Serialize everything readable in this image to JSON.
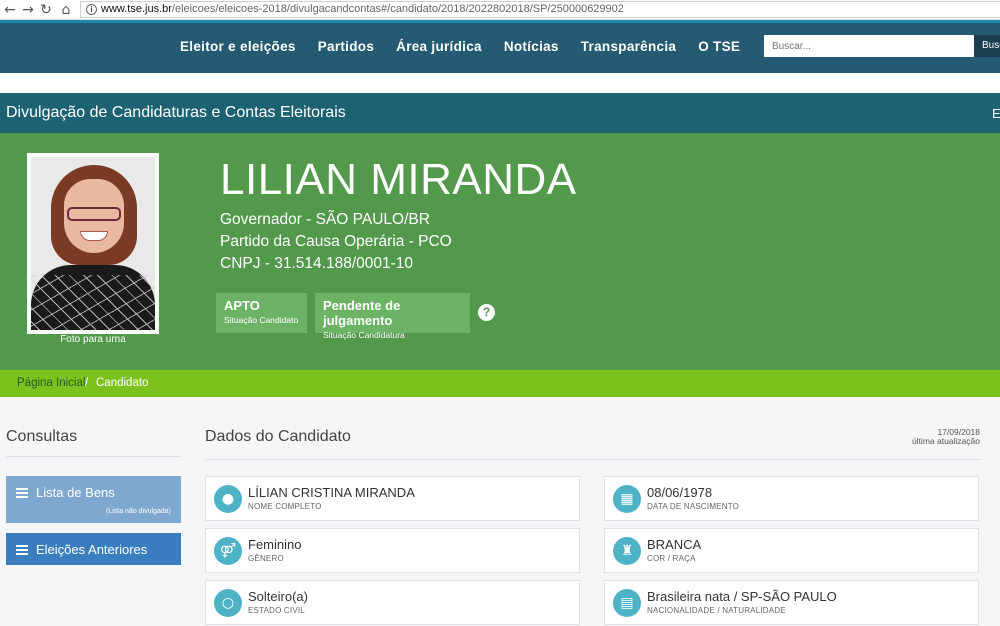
{
  "browser": {
    "url_host": "www.tse.jus.br",
    "url_path": "/eleicoes/eleicoes-2018/divulgacandcontas#/candidato/2018/2022802018/SP/250000629902"
  },
  "topnav": {
    "items": [
      "Eleitor e eleições",
      "Partidos",
      "Área jurídica",
      "Notícias",
      "Transparência",
      "O TSE"
    ],
    "search_placeholder": "Buscar...",
    "search_button": "Buscar"
  },
  "section": {
    "title": "Divulgação de Candidaturas e Contas Eleitorais",
    "edge_text": "E"
  },
  "candidate": {
    "photo_caption": "Foto para urna",
    "name": "LILIAN MIRANDA",
    "office": "Governador - SÃO PAULO/BR",
    "party": "Partido da Causa Operária - PCO",
    "cnpj": "CNPJ - 31.514.188/0001-10",
    "badges": [
      {
        "main": "APTO",
        "sub": "Situação Candidato"
      },
      {
        "main": "Pendente de julgamento",
        "sub": "Situação Candidatura"
      }
    ],
    "help": "?"
  },
  "breadcrumb": {
    "home": "Página Inicial",
    "separator": "/",
    "current": "Candidato"
  },
  "sidebar": {
    "title": "Consultas",
    "items": [
      {
        "label": "Lista de Bens",
        "note": "(Lista não divulgada)",
        "color": "#7fa8d1"
      },
      {
        "label": "Eleições Anteriores",
        "note": "",
        "color": "#3a7ec0"
      }
    ]
  },
  "main": {
    "title": "Dados do Candidato",
    "update_date": "17/09/2018",
    "update_label": "última atualização",
    "fields": [
      {
        "value": "LÍLIAN CRISTINA MIRANDA",
        "label": "NOME COMPLETO",
        "icon": "person-icon"
      },
      {
        "value": "08/06/1978",
        "label": "DATA DE NASCIMENTO",
        "icon": "calendar-icon"
      },
      {
        "value": "Feminino",
        "label": "GÊNERO",
        "icon": "gender-icon"
      },
      {
        "value": "BRANCA",
        "label": "COR / RAÇA",
        "icon": "race-icon"
      },
      {
        "value": "Solteiro(a)",
        "label": "ESTADO CIVIL",
        "icon": "ring-icon"
      },
      {
        "value": "Brasileira nata / SP-SÃO PAULO",
        "label": "NACIONALIDADE / NATURALIDADE",
        "icon": "map-icon"
      }
    ]
  },
  "colors": {
    "nav": "#245a72",
    "section": "#1d6273",
    "hero": "#52994c",
    "breadcrumb": "#7cc21e",
    "icon_circle": "#4fb3c7"
  }
}
